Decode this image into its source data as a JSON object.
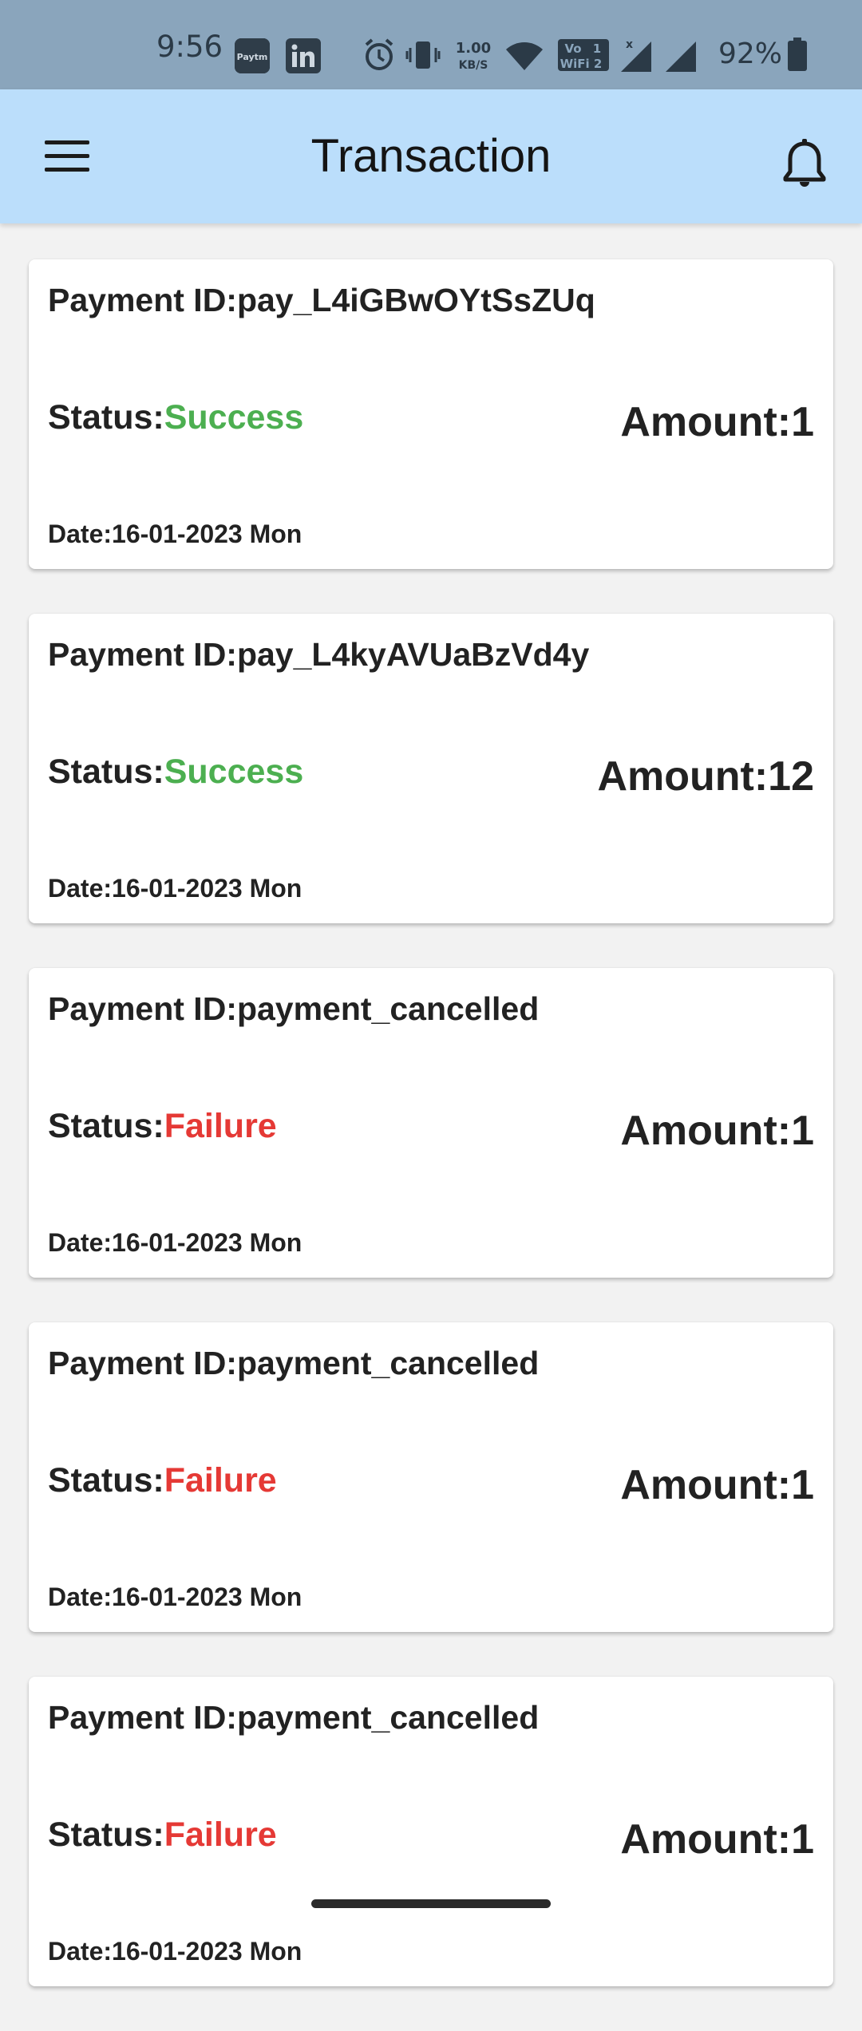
{
  "status_bar": {
    "time": "9:56",
    "net_speed_value": "1.00",
    "net_speed_unit": "KB/S",
    "battery_percent": "92%",
    "icons": [
      "paytm-icon",
      "linkedin-icon",
      "alarm-icon",
      "vibrate-icon",
      "network-speed-icon",
      "wifi-icon",
      "vowifi-icon",
      "signal-icon",
      "signal-icon",
      "battery-icon"
    ]
  },
  "app_bar": {
    "title": "Transaction",
    "menu_icon": "hamburger-menu-icon",
    "notification_icon": "bell-icon"
  },
  "transactions": [
    {
      "payment_id": "Payment ID:pay_L4iGBwOYtSsZUq",
      "status_label": "Status:",
      "status": "Success",
      "amount": "Amount:1",
      "date": "Date:16-01-2023 Mon"
    },
    {
      "payment_id": "Payment ID:pay_L4kyAVUaBzVd4y",
      "status_label": "Status:",
      "status": "Success",
      "amount": "Amount:12",
      "date": "Date:16-01-2023 Mon"
    },
    {
      "payment_id": "Payment ID:payment_cancelled",
      "status_label": "Status:",
      "status": "Failure",
      "amount": "Amount:1",
      "date": "Date:16-01-2023 Mon"
    },
    {
      "payment_id": "Payment ID:payment_cancelled",
      "status_label": "Status:",
      "status": "Failure",
      "amount": "Amount:1",
      "date": "Date:16-01-2023 Mon"
    },
    {
      "payment_id": "Payment ID:payment_cancelled",
      "status_label": "Status:",
      "status": "Failure",
      "amount": "Amount:1",
      "date": "Date:16-01-2023 Mon"
    }
  ],
  "colors": {
    "app_bar": "#bbdefb",
    "status_bar": "#8aa5bc",
    "success": "#4caf50",
    "failure": "#e53935",
    "background": "#f2f2f2"
  }
}
